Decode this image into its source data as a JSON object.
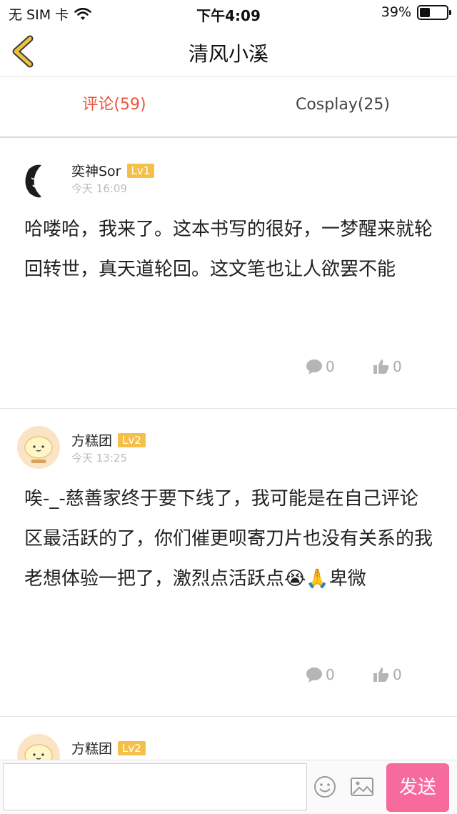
{
  "status_bar": {
    "carrier": "无 SIM 卡",
    "time": "下午4:09",
    "battery": "39%",
    "battery_level": 0.39
  },
  "nav": {
    "title": "清风小溪",
    "back_icon": "chevron-left-icon"
  },
  "tabs": [
    {
      "label": "评论(59)",
      "active": true
    },
    {
      "label": "Cosplay(25)",
      "active": false
    }
  ],
  "comments": [
    {
      "username": "奕神Sor",
      "level": "Lv1",
      "time": "今天 16:09",
      "text": "哈喽哈，我来了。这本书写的很好，一梦醒来就轮回转世，真天道轮回。这文笔也让人欲罢不能",
      "reply_count": "0",
      "like_count": "0"
    },
    {
      "username": "方糕团",
      "level": "Lv2",
      "time": "今天 13:25",
      "text": "唉-_-慈善家终于要下线了，我可能是在自己评论区最活跃的了，你们催更呗寄刀片也没有关系的我老想体验一把了，激烈点活跃点😭🙏卑微",
      "reply_count": "0",
      "like_count": "0"
    },
    {
      "username": "方糕团",
      "level": "Lv2",
      "time": "",
      "text": "",
      "reply_count": "",
      "like_count": ""
    }
  ],
  "bottom_bar": {
    "input_value": "",
    "emoji_icon": "smiley-icon",
    "image_icon": "image-icon",
    "send_label": "发送"
  },
  "colors": {
    "accent": "#e9553a",
    "level_badge": "#f5c04a",
    "send_button": "#f66a9c",
    "back_arrow": "#f0c23a"
  }
}
